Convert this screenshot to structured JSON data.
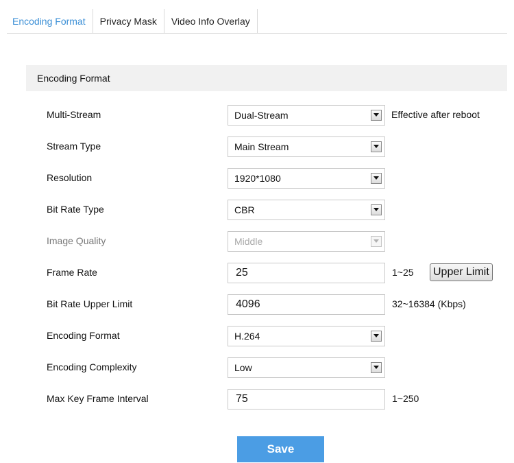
{
  "tabs": [
    {
      "label": "Encoding Format",
      "active": true
    },
    {
      "label": "Privacy Mask",
      "active": false
    },
    {
      "label": "Video Info Overlay",
      "active": false
    }
  ],
  "section": {
    "title": "Encoding Format"
  },
  "fields": {
    "multi_stream": {
      "label": "Multi-Stream",
      "value": "Dual-Stream",
      "hint": "Effective after reboot"
    },
    "stream_type": {
      "label": "Stream Type",
      "value": "Main Stream"
    },
    "resolution": {
      "label": "Resolution",
      "value": "1920*1080"
    },
    "bit_rate_type": {
      "label": "Bit Rate Type",
      "value": "CBR"
    },
    "image_quality": {
      "label": "Image Quality",
      "value": "Middle",
      "disabled": true
    },
    "frame_rate": {
      "label": "Frame Rate",
      "value": "25",
      "hint": "1~25",
      "button": "Upper Limit"
    },
    "bit_rate_upper_limit": {
      "label": "Bit Rate Upper Limit",
      "value": "4096",
      "hint": "32~16384 (Kbps)"
    },
    "encoding_format": {
      "label": "Encoding Format",
      "value": "H.264"
    },
    "encoding_complexity": {
      "label": "Encoding Complexity",
      "value": "Low"
    },
    "max_key_frame_interval": {
      "label": "Max Key Frame Interval",
      "value": "75",
      "hint": "1~250"
    }
  },
  "save_label": "Save",
  "colors": {
    "accent": "#4b9de4",
    "active_tab": "#3b8fd6",
    "section_bg": "#f1f1f1"
  },
  "icons": {
    "dropdown": "chevron-down-icon"
  }
}
